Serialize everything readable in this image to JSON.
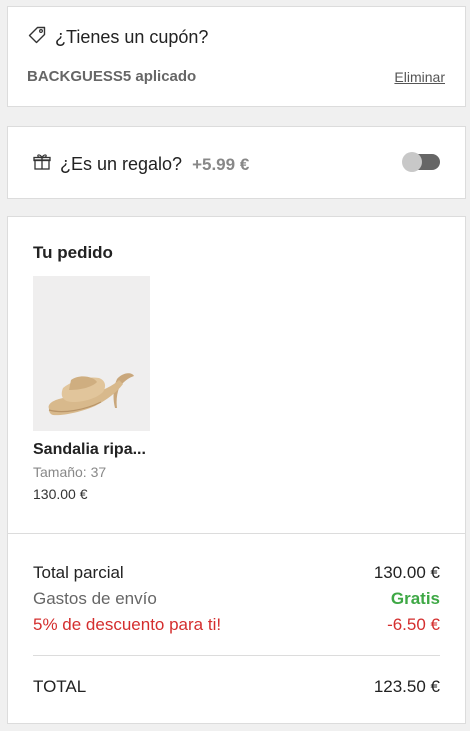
{
  "coupon": {
    "title": "¿Tienes un cupón?",
    "applied_text": "BACKGUESS5 aplicado",
    "remove_label": "Eliminar",
    "icon": "tag-icon"
  },
  "gift": {
    "title": "¿Es un regalo?",
    "price": "+5.99 €",
    "icon": "gift-icon",
    "toggle_on": false
  },
  "order": {
    "title": "Tu pedido",
    "items": [
      {
        "name": "Sandalia ripa...",
        "size": "Tamaño: 37",
        "price": "130.00 €"
      }
    ],
    "summary": {
      "subtotal_label": "Total parcial",
      "subtotal_value": "130.00 €",
      "shipping_label": "Gastos de envío",
      "shipping_value": "Gratis",
      "discount_label": "5% de descuento para ti!",
      "discount_value": "-6.50 €",
      "total_label": "TOTAL",
      "total_value": "123.50 €"
    }
  },
  "colors": {
    "free_shipping": "#3ea845",
    "discount": "#d42e2e"
  }
}
